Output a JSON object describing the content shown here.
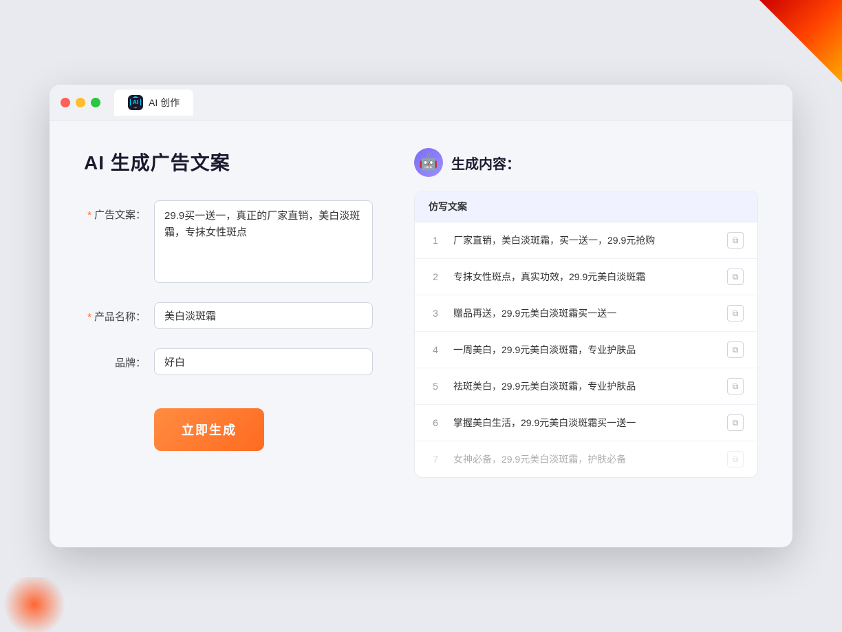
{
  "window": {
    "tab_label": "AI 创作"
  },
  "left_panel": {
    "title": "AI 生成广告文案",
    "form": {
      "ad_copy_label": "广告文案：",
      "ad_copy_required": "*",
      "ad_copy_value": "29.9买一送一，真正的厂家直销，美白淡斑霜，专抹女性斑点",
      "product_name_label": "产品名称：",
      "product_name_required": "*",
      "product_name_value": "美白淡斑霜",
      "brand_label": "品牌：",
      "brand_value": "好白"
    },
    "generate_button": "立即生成"
  },
  "right_panel": {
    "title": "生成内容：",
    "results_header": "仿写文案",
    "results": [
      {
        "num": "1",
        "text": "厂家直销，美白淡斑霜，买一送一，29.9元抢购",
        "faded": false
      },
      {
        "num": "2",
        "text": "专抹女性斑点，真实功效，29.9元美白淡斑霜",
        "faded": false
      },
      {
        "num": "3",
        "text": "赠品再送，29.9元美白淡斑霜买一送一",
        "faded": false
      },
      {
        "num": "4",
        "text": "一周美白，29.9元美白淡斑霜，专业护肤品",
        "faded": false
      },
      {
        "num": "5",
        "text": "祛斑美白，29.9元美白淡斑霜，专业护肤品",
        "faded": false
      },
      {
        "num": "6",
        "text": "掌握美白生活，29.9元美白淡斑霜买一送一",
        "faded": false
      },
      {
        "num": "7",
        "text": "女神必备，29.9元美白淡斑霜，护肤必备",
        "faded": true
      }
    ]
  },
  "colors": {
    "accent": "#ff6b20",
    "primary": "#6c63ff"
  }
}
